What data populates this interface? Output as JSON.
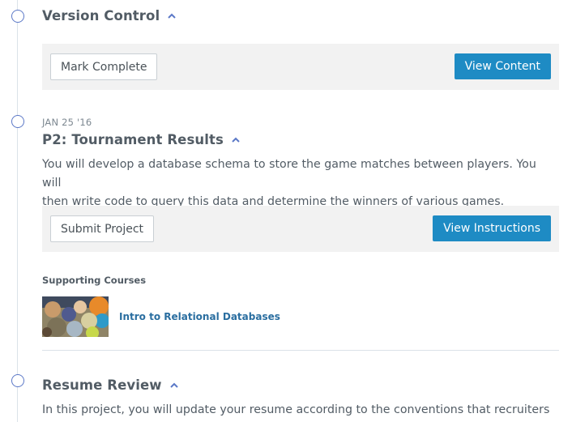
{
  "sections": [
    {
      "title": "Version Control",
      "actions": {
        "secondary": "Mark Complete",
        "primary": "View Content"
      }
    },
    {
      "date": "JAN 25 '16",
      "title": "P2: Tournament Results",
      "description_line1": "You will develop a database schema to store the game matches between players. You will",
      "description_line2": "then write code to query this data and determine the winners of various games.",
      "actions": {
        "secondary": "Submit Project",
        "primary": "View Instructions"
      },
      "supporting": {
        "label": "Supporting Courses",
        "courses": [
          {
            "name": "Intro to Relational Databases"
          }
        ]
      }
    },
    {
      "title": "Resume Review",
      "description_line1": "In this project, you will update your resume according to the conventions that recruiters"
    }
  ],
  "icons": {
    "timeline_node": "circle-outline-icon",
    "collapse": "caret-up-icon"
  },
  "colors": {
    "accent": "#5b78c7",
    "primary_button": "#1e8bc4",
    "link": "#2a6ea0",
    "text": "#525c65",
    "action_bar_bg": "#f2f2f2"
  }
}
